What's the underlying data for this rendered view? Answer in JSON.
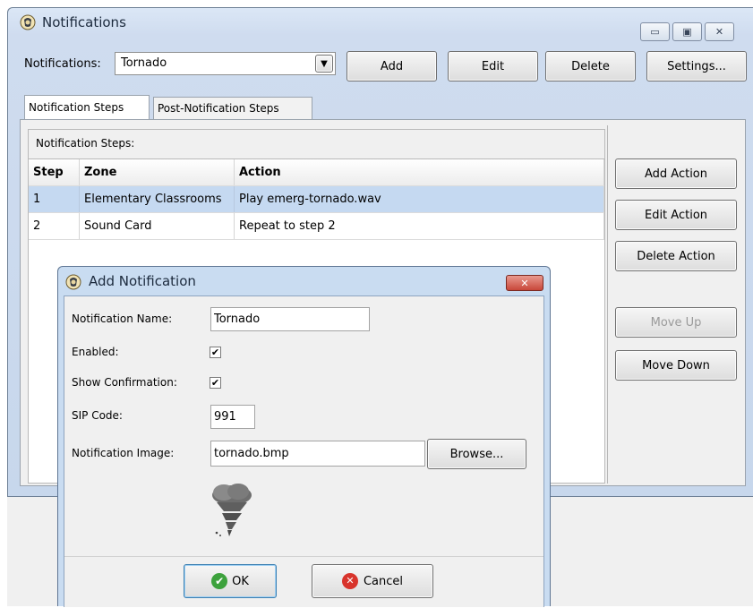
{
  "window": {
    "title": "Notifications",
    "controls": {
      "minimize": "▭",
      "maximize": "▣",
      "close": "✕"
    }
  },
  "toolbar": {
    "notifications_label": "Notifications:",
    "selected_notification": "Tornado",
    "add_label": "Add",
    "edit_label": "Edit",
    "delete_label": "Delete",
    "settings_label": "Settings..."
  },
  "tabs": [
    {
      "label": "Notification Steps",
      "active": true
    },
    {
      "label": "Post-Notification Steps",
      "active": false
    }
  ],
  "steps_panel": {
    "label": "Notification Steps:",
    "columns": [
      "Step",
      "Zone",
      "Action"
    ],
    "rows": [
      {
        "step": "1",
        "zone": "Elementary Classrooms",
        "action": "Play emerg-tornado.wav",
        "selected": true
      },
      {
        "step": "2",
        "zone": "Sound Card",
        "action": "Repeat to step 2",
        "selected": false
      }
    ]
  },
  "side_buttons": {
    "add_action": "Add Action",
    "edit_action": "Edit Action",
    "delete_action": "Delete Action",
    "move_up": "Move Up",
    "move_down": "Move Down"
  },
  "dialog": {
    "title": "Add Notification",
    "name_label": "Notification Name:",
    "name_value": "Tornado",
    "enabled_label": "Enabled:",
    "enabled_checked": true,
    "show_confirmation_label": "Show Confirmation:",
    "show_confirmation_checked": true,
    "sip_label": "SIP Code:",
    "sip_value": "991",
    "image_label": "Notification Image:",
    "image_value": "tornado.bmp",
    "browse_label": "Browse...",
    "ok_label": "OK",
    "cancel_label": "Cancel"
  },
  "colors": {
    "selected_row": "#c5d9f1",
    "dialog_title_bg": "#c9dcf1",
    "close_button": "#c8473a",
    "ok_icon": "#3da23d",
    "cancel_icon": "#d8342c"
  }
}
